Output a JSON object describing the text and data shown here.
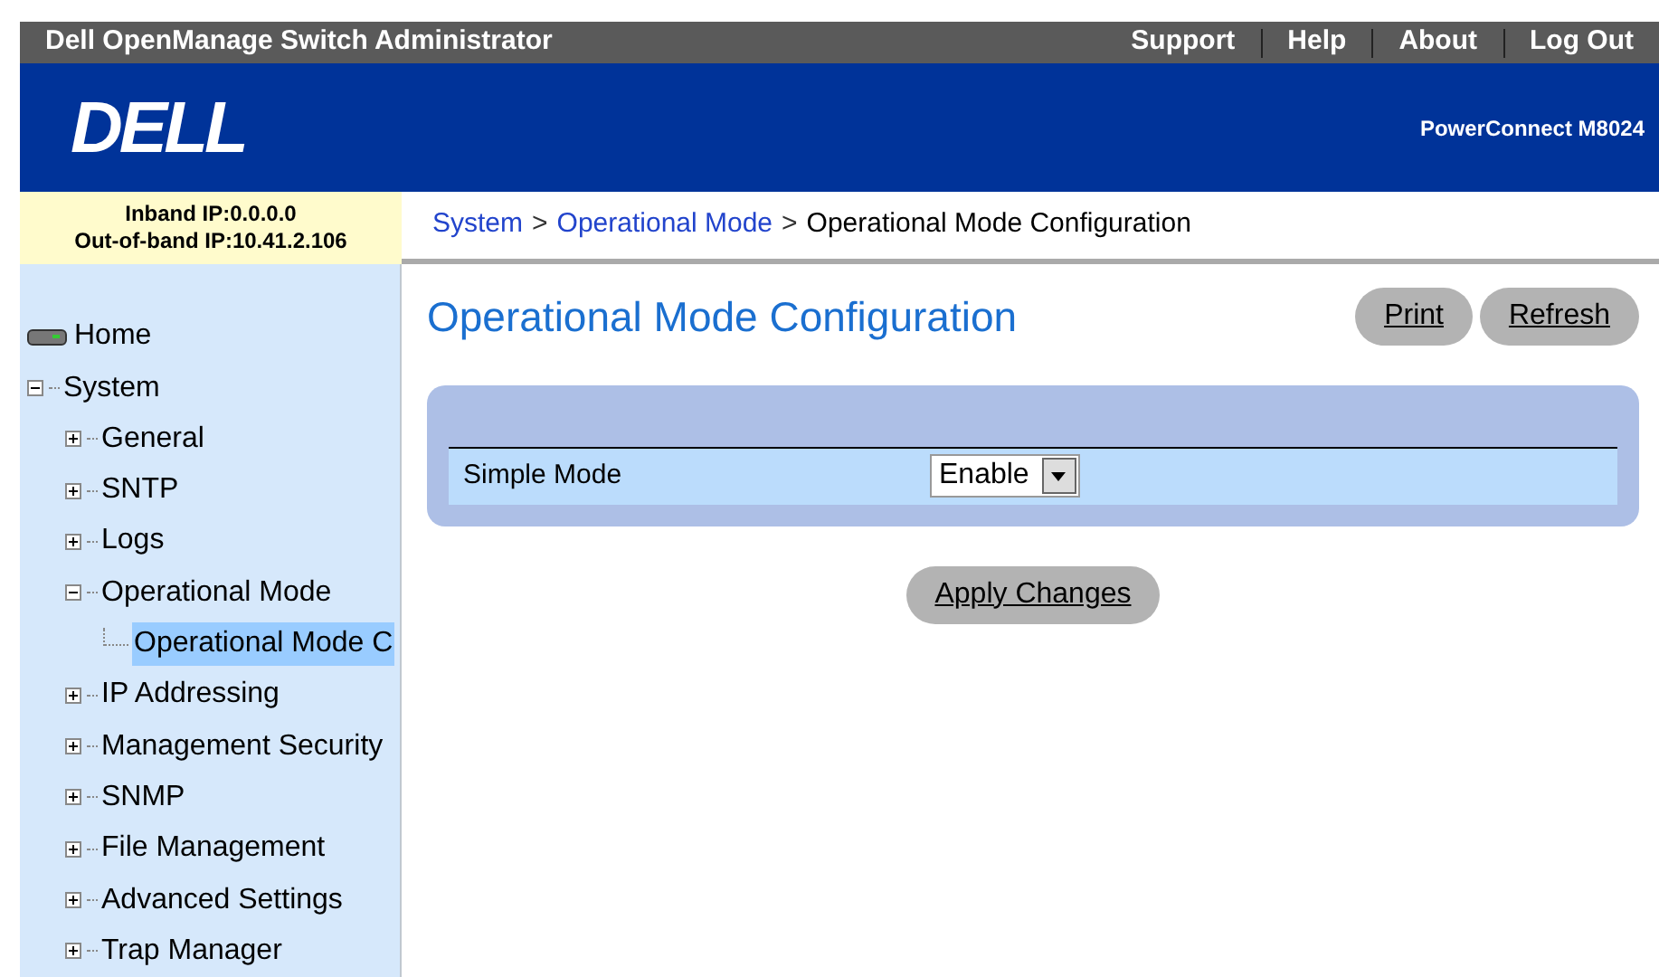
{
  "top_bar": {
    "title": "Dell OpenManage Switch Administrator",
    "links": [
      "Support",
      "Help",
      "About",
      "Log Out"
    ]
  },
  "banner": {
    "logo": "DELL",
    "model": "PowerConnect M8024"
  },
  "ip_info": {
    "inband": "Inband IP:0.0.0.0",
    "out_of_band": "Out-of-band IP:10.41.2.106"
  },
  "breadcrumb": {
    "items": [
      "System",
      "Operational Mode",
      "Operational Mode Configuration"
    ],
    "separators": [
      ">",
      ">"
    ]
  },
  "tree": [
    {
      "label": "Home",
      "kind": "home",
      "selected": false
    },
    {
      "label": "System",
      "kind": "node",
      "expanded": true,
      "selected": false,
      "children": [
        {
          "label": "General",
          "kind": "node",
          "expanded": false,
          "selected": false
        },
        {
          "label": "SNTP",
          "kind": "node",
          "expanded": false,
          "selected": false
        },
        {
          "label": "Logs",
          "kind": "node",
          "expanded": false,
          "selected": false
        },
        {
          "label": "Operational Mode",
          "kind": "node",
          "expanded": true,
          "selected": false,
          "children": [
            {
              "label": "Operational Mode C",
              "kind": "leaf",
              "selected": true
            }
          ]
        },
        {
          "label": "IP Addressing",
          "kind": "node",
          "expanded": false,
          "selected": false
        },
        {
          "label": "Management Security",
          "kind": "node",
          "expanded": false,
          "selected": false
        },
        {
          "label": "SNMP",
          "kind": "node",
          "expanded": false,
          "selected": false
        },
        {
          "label": "File Management",
          "kind": "node",
          "expanded": false,
          "selected": false
        },
        {
          "label": "Advanced Settings",
          "kind": "node",
          "expanded": false,
          "selected": false
        },
        {
          "label": "Trap Manager",
          "kind": "node",
          "expanded": false,
          "selected": false
        }
      ]
    }
  ],
  "page": {
    "title": "Operational Mode Configuration",
    "buttons": [
      "Print",
      "Refresh"
    ],
    "fields": [
      {
        "label": "Simple Mode",
        "value": "Enable"
      }
    ],
    "apply": "Apply Changes"
  }
}
